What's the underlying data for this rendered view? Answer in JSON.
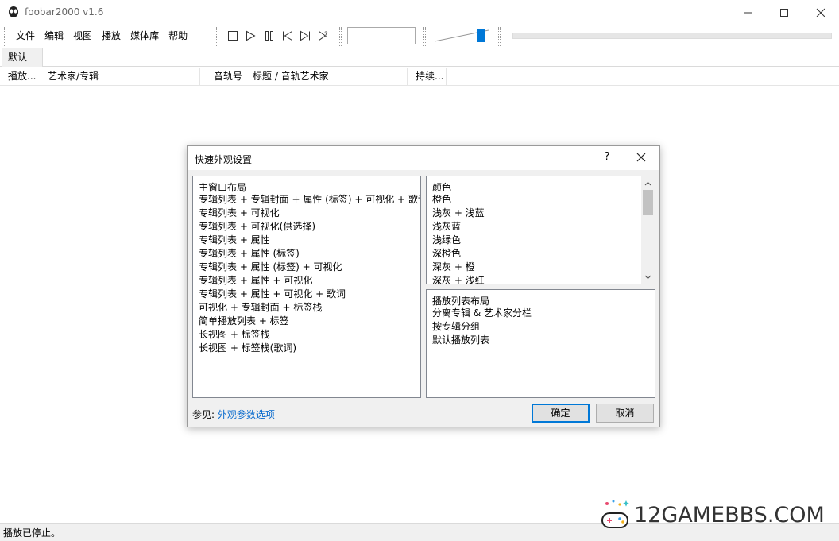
{
  "window": {
    "title": "foobar2000 v1.6"
  },
  "menu": [
    "文件",
    "编辑",
    "视图",
    "播放",
    "媒体库",
    "帮助"
  ],
  "toolbar": {
    "buttons": [
      "stop-icon",
      "play-icon",
      "pause-icon",
      "previous-icon",
      "next-icon",
      "random-icon"
    ],
    "volume_level": 0.85
  },
  "tabs": [
    "默认"
  ],
  "columns": [
    "播放...",
    "艺术家/专辑",
    "音轨号",
    "标题 / 音轨艺术家",
    "持续..."
  ],
  "status": "播放已停止。",
  "dialog": {
    "title": "快速外观设置",
    "help": "?",
    "layout_header": "主窗口布局",
    "layouts": [
      "专辑列表 + 专辑封面 + 属性 (标签) + 可视化 + 歌词",
      "专辑列表 + 可视化",
      "专辑列表 + 可视化(供选择)",
      "专辑列表 + 属性",
      "专辑列表 + 属性 (标签)",
      "专辑列表 + 属性 (标签) + 可视化",
      "专辑列表 + 属性 + 可视化",
      "专辑列表 + 属性 + 可视化 + 歌词",
      "可视化 + 专辑封面 + 标签栈",
      "简单播放列表 + 标签",
      "长视图 + 标签栈",
      "长视图 + 标签栈(歌词)"
    ],
    "colors_header": "颜色",
    "colors": [
      "橙色",
      "浅灰 + 浅蓝",
      "浅灰蓝",
      "浅绿色",
      "深橙色",
      "深灰 + 橙",
      "深灰 + 浅红"
    ],
    "playlist_header": "播放列表布局",
    "playlist_layouts": [
      "分离专辑 & 艺术家分栏",
      "按专辑分组",
      "默认播放列表"
    ],
    "see_also_label": "参见:",
    "see_also_link": "外观参数选项",
    "ok": "确定",
    "cancel": "取消"
  },
  "watermark": {
    "text": "12GAMEBBS.COM"
  }
}
